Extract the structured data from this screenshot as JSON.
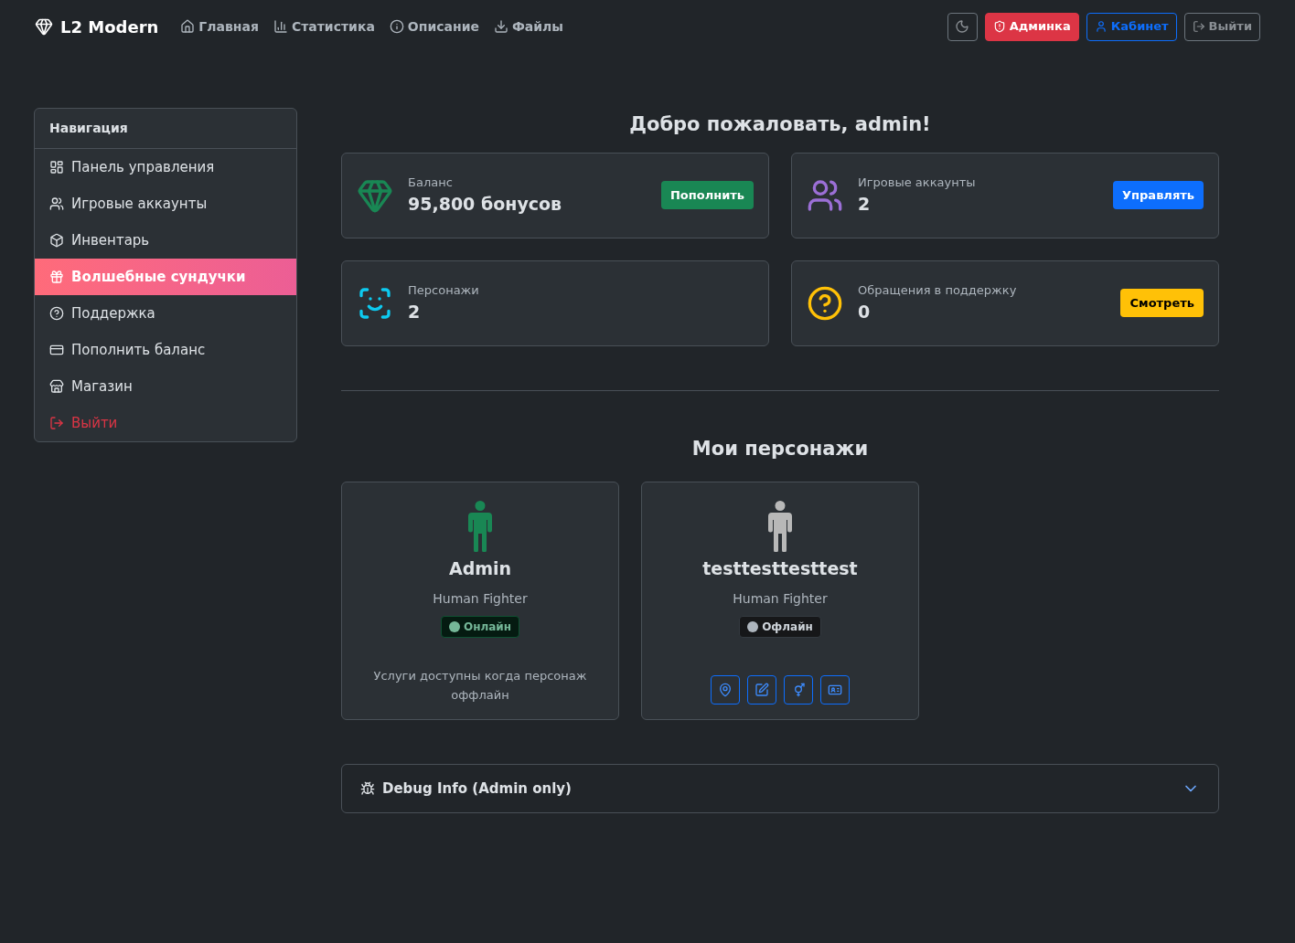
{
  "header": {
    "brand": "L2 Modern",
    "links": [
      "Главная",
      "Статистика",
      "Описание",
      "Файлы"
    ],
    "buttons": [
      {
        "kind": "admin",
        "label": "Админка"
      },
      {
        "kind": "cabinet",
        "label": "Кабинет"
      },
      {
        "kind": "logout",
        "label": "Выйти"
      }
    ]
  },
  "sidebar": {
    "title": "Навигация",
    "items": [
      {
        "label": "Панель управления",
        "selected": false,
        "kind": "normal"
      },
      {
        "label": "Игровые аккаунты",
        "selected": false,
        "kind": "normal"
      },
      {
        "label": "Инвентарь",
        "selected": false,
        "kind": "normal"
      },
      {
        "label": "Волшебные сундучки",
        "selected": true,
        "kind": "normal"
      },
      {
        "label": "Поддержка",
        "selected": false,
        "kind": "normal"
      },
      {
        "label": "Пополнить баланс",
        "selected": false,
        "kind": "normal"
      },
      {
        "label": "Магазин",
        "selected": false,
        "kind": "normal"
      },
      {
        "label": "Выйти",
        "selected": false,
        "kind": "danger"
      }
    ]
  },
  "welcome": "Добро пожаловать, admin!",
  "stats": [
    {
      "kind": "balance",
      "label": "Баланс",
      "value": "95,800 бонусов",
      "button": "Пополнить"
    },
    {
      "kind": "accounts",
      "label": "Игровые аккаунты",
      "value": "2",
      "button": "Управлять"
    },
    {
      "kind": "characters",
      "label": "Персонажи",
      "value": "2"
    },
    {
      "kind": "support",
      "label": "Обращения в поддержку",
      "value": "0",
      "button": "Смотреть"
    }
  ],
  "characters_title": "Мои персонажи",
  "characters": [
    {
      "name": "Admin",
      "class": "Human Fighter",
      "online": true,
      "status": "Онлайн",
      "note": "Услуги доступны когда персонаж оффлайн"
    },
    {
      "name": "testtesttesttest",
      "class": "Human Fighter",
      "online": false,
      "status": "Офлайн"
    }
  ],
  "debug": {
    "title": "Debug Info (Admin only)",
    "expanded": false
  }
}
